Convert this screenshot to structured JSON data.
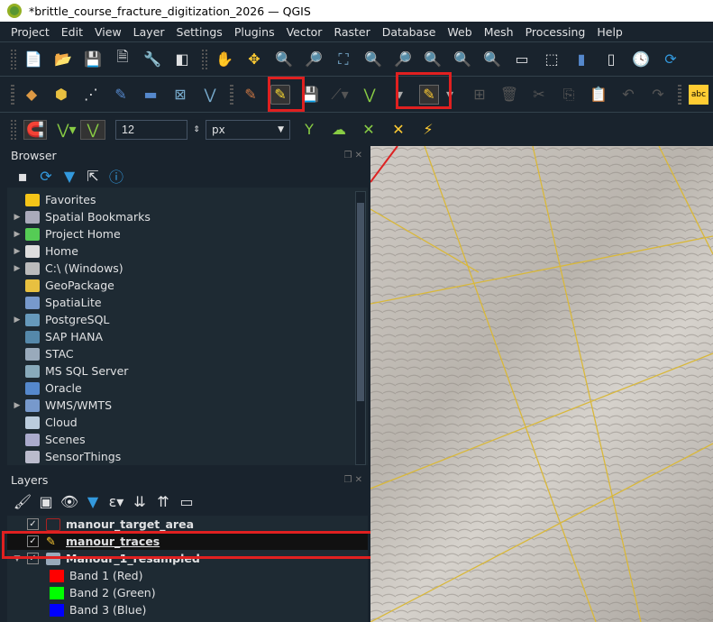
{
  "title": "*brittle_course_fracture_digitization_2026 — QGIS",
  "menu": [
    "Project",
    "Edit",
    "View",
    "Layer",
    "Settings",
    "Plugins",
    "Vector",
    "Raster",
    "Database",
    "Web",
    "Mesh",
    "Processing",
    "Help"
  ],
  "snapping": {
    "tolerance": "12",
    "unit": "px"
  },
  "browser": {
    "title": "Browser",
    "items": [
      {
        "label": "Favorites",
        "expand": false,
        "color": "#f5c518"
      },
      {
        "label": "Spatial Bookmarks",
        "expand": true,
        "color": "#aab"
      },
      {
        "label": "Project Home",
        "expand": true,
        "color": "#5c5"
      },
      {
        "label": "Home",
        "expand": true,
        "color": "#ddd"
      },
      {
        "label": "C:\\ (Windows)",
        "expand": true,
        "color": "#bbb"
      },
      {
        "label": "GeoPackage",
        "expand": false,
        "color": "#e8c040"
      },
      {
        "label": "SpatiaLite",
        "expand": false,
        "color": "#79c"
      },
      {
        "label": "PostgreSQL",
        "expand": true,
        "color": "#69b"
      },
      {
        "label": "SAP HANA",
        "expand": false,
        "color": "#58a"
      },
      {
        "label": "STAC",
        "expand": false,
        "color": "#9ab"
      },
      {
        "label": "MS SQL Server",
        "expand": false,
        "color": "#8ab"
      },
      {
        "label": "Oracle",
        "expand": false,
        "color": "#58c"
      },
      {
        "label": "WMS/WMTS",
        "expand": true,
        "color": "#79c"
      },
      {
        "label": "Cloud",
        "expand": false,
        "color": "#bcd"
      },
      {
        "label": "Scenes",
        "expand": false,
        "color": "#aac"
      },
      {
        "label": "SensorThings",
        "expand": false,
        "color": "#bbc"
      }
    ]
  },
  "layers": {
    "title": "Layers",
    "items": [
      {
        "label": "manour_target_area",
        "bold": true
      },
      {
        "label": "manour_traces",
        "bold": true,
        "underline": true
      },
      {
        "label": "Manour_1_resampled",
        "bold": true
      }
    ],
    "bands": [
      {
        "label": "Band 1 (Red)",
        "color": "#ff0000"
      },
      {
        "label": "Band 2 (Green)",
        "color": "#00ff00"
      },
      {
        "label": "Band 3 (Blue)",
        "color": "#0000ff"
      }
    ]
  }
}
